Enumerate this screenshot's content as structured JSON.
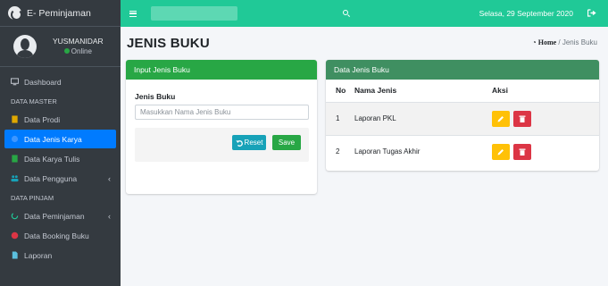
{
  "app": {
    "brand": "E- Peminjaman"
  },
  "user": {
    "name": "YUSMANIDAR",
    "status": "Online"
  },
  "sidebar": {
    "items": [
      {
        "label": "Dashboard"
      },
      {
        "header": "DATA MASTER"
      },
      {
        "label": "Data Prodi"
      },
      {
        "label": "Data Jenis Karya",
        "active": true
      },
      {
        "label": "Data Karya Tulis"
      },
      {
        "label": "Data Pengguna"
      },
      {
        "header": "DATA PINJAM"
      },
      {
        "label": "Data Peminjaman"
      },
      {
        "label": "Data Booking Buku"
      },
      {
        "label": "Laporan"
      }
    ]
  },
  "topbar": {
    "date": "Selasa, 29 September 2020",
    "search_placeholder": ""
  },
  "page": {
    "title": "JENIS BUKU",
    "breadcrumb_home": "Home",
    "breadcrumb_sep": "/",
    "breadcrumb_current": "Jenis Buku"
  },
  "form": {
    "header": "Input Jenis Buku",
    "label": "Jenis Buku",
    "placeholder": "Masukkan Nama Jenis Buku",
    "reset_label": "Reset",
    "save_label": "Save"
  },
  "table": {
    "header": "Data Jenis Buku",
    "columns": [
      "No",
      "Nama Jenis",
      "Aksi"
    ],
    "rows": [
      {
        "no": "1",
        "name": "Laporan PKL"
      },
      {
        "no": "2",
        "name": "Laporan Tugas Akhir"
      }
    ]
  },
  "colors": {
    "topbar": "#20c997",
    "sidebar": "#343a40",
    "active": "#007bff",
    "card_header": "#28a745",
    "edit": "#ffc107",
    "delete": "#dc3545",
    "reset": "#17a2b8"
  }
}
